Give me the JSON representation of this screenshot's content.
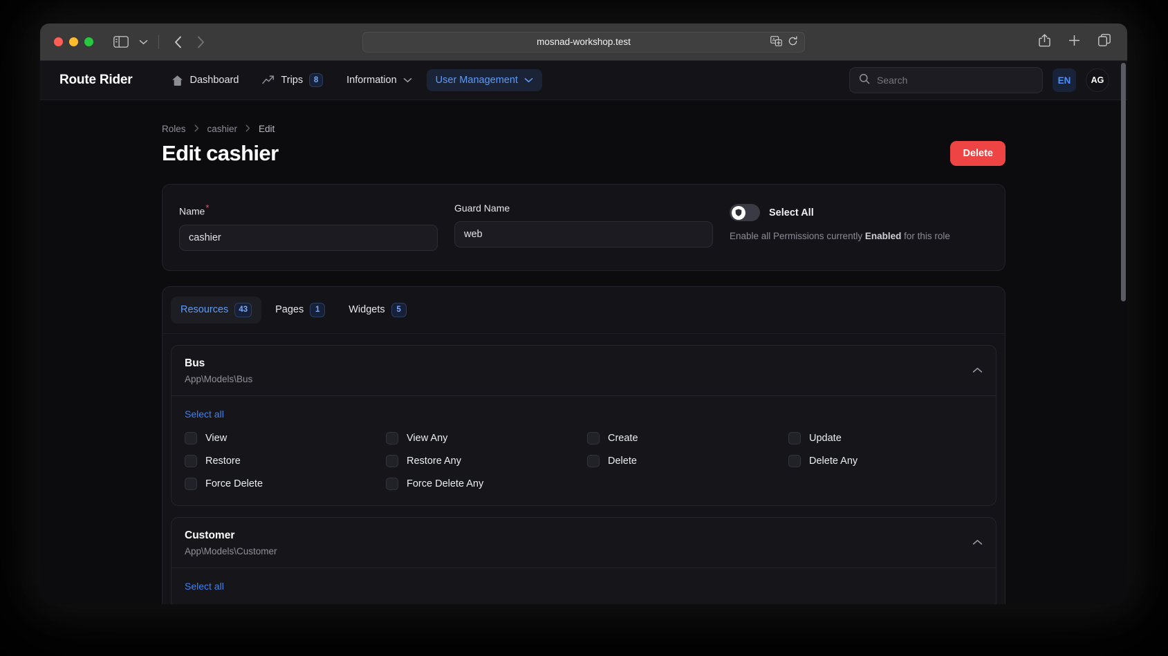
{
  "browser": {
    "url": "mosnad-workshop.test",
    "icons": {
      "sidebar": "sidebar-icon",
      "tab_overview_chevron": "chevron-down-icon",
      "back": "chevron-left-icon",
      "forward": "chevron-right-icon",
      "translate": "translate-icon",
      "reload": "reload-icon",
      "share": "share-icon",
      "new_tab": "plus-icon",
      "tabs": "tab-overview-icon"
    }
  },
  "appbar": {
    "brand": "Route Rider",
    "nav": [
      {
        "label": "Dashboard",
        "icon": "home-icon",
        "badge": null,
        "active": false,
        "chevron": false
      },
      {
        "label": "Trips",
        "icon": "trend-up-icon",
        "badge": "8",
        "active": false,
        "chevron": false
      },
      {
        "label": "Information",
        "icon": null,
        "badge": null,
        "active": false,
        "chevron": true
      },
      {
        "label": "User Management",
        "icon": null,
        "badge": null,
        "active": true,
        "chevron": true
      }
    ],
    "search": {
      "placeholder": "Search",
      "value": ""
    },
    "language": "EN",
    "avatar": "AG"
  },
  "breadcrumb": {
    "items": [
      "Roles",
      "cashier",
      "Edit"
    ],
    "separator": "›"
  },
  "header": {
    "title": "Edit cashier",
    "delete_label": "Delete"
  },
  "form": {
    "name": {
      "label": "Name",
      "required_mark": "*",
      "value": "cashier"
    },
    "guard_name": {
      "label": "Guard Name",
      "value": "web"
    },
    "select_all": {
      "label": "Select All",
      "state": "off",
      "help_prefix": "Enable all Permissions currently ",
      "help_bold": "Enabled",
      "help_suffix": " for this role"
    }
  },
  "tabs": [
    {
      "label": "Resources",
      "badge": "43",
      "active": true
    },
    {
      "label": "Pages",
      "badge": "1",
      "active": false
    },
    {
      "label": "Widgets",
      "badge": "5",
      "active": false
    }
  ],
  "sections": [
    {
      "title": "Bus",
      "subtitle": "App\\Models\\Bus",
      "select_all_label": "Select all",
      "collapse_icon": "chevron-up-icon",
      "permissions": [
        {
          "label": "View",
          "checked": false
        },
        {
          "label": "View Any",
          "checked": false
        },
        {
          "label": "Create",
          "checked": false
        },
        {
          "label": "Update",
          "checked": false
        },
        {
          "label": "Restore",
          "checked": false
        },
        {
          "label": "Restore Any",
          "checked": false
        },
        {
          "label": "Delete",
          "checked": false
        },
        {
          "label": "Delete Any",
          "checked": false
        },
        {
          "label": "Force Delete",
          "checked": false
        },
        {
          "label": "Force Delete Any",
          "checked": false
        }
      ]
    },
    {
      "title": "Customer",
      "subtitle": "App\\Models\\Customer",
      "select_all_label": "Select all",
      "collapse_icon": "chevron-up-icon",
      "permissions": []
    }
  ],
  "colors": {
    "accent": "#3b82f6",
    "danger": "#ef4444",
    "page_bg": "#0c0c0e",
    "card_bg": "#141418"
  }
}
